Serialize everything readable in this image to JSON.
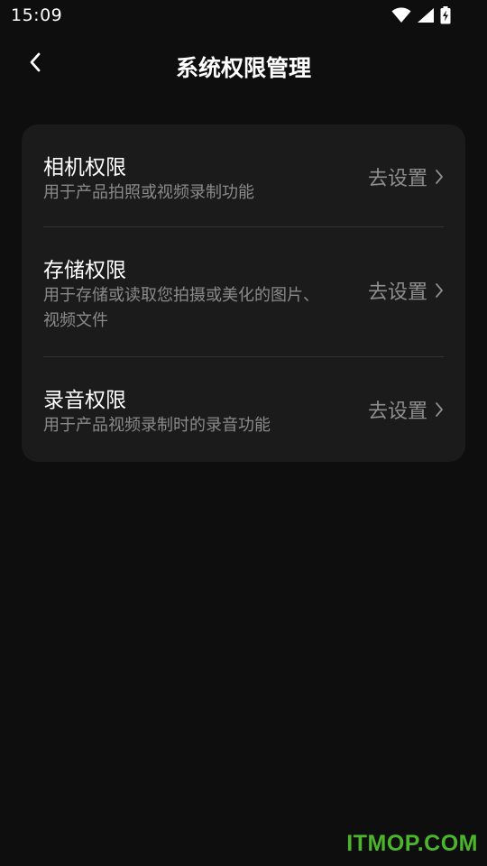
{
  "status_bar": {
    "time": "15:09",
    "icons": [
      "wifi-icon",
      "cellular-signal-icon",
      "battery-charging-icon"
    ]
  },
  "header": {
    "back_icon": "chevron-left-icon",
    "title": "系统权限管理"
  },
  "permissions": [
    {
      "title": "相机权限",
      "description": "用于产品拍照或视频录制功能",
      "action": "去设置",
      "action_icon": "chevron-right-icon"
    },
    {
      "title": "存储权限",
      "description": "用于存储或读取您拍摄或美化的图片、视频文件",
      "action": "去设置",
      "action_icon": "chevron-right-icon"
    },
    {
      "title": "录音权限",
      "description": "用于产品视频录制时的录音功能",
      "action": "去设置",
      "action_icon": "chevron-right-icon"
    }
  ],
  "watermark": "ITMOP.COM",
  "colors": {
    "background": "#0e0e0e",
    "card": "#1b1b1b",
    "primary_text": "#ffffff",
    "secondary_text": "#8a8a8a",
    "watermark": "#4bb52c"
  }
}
